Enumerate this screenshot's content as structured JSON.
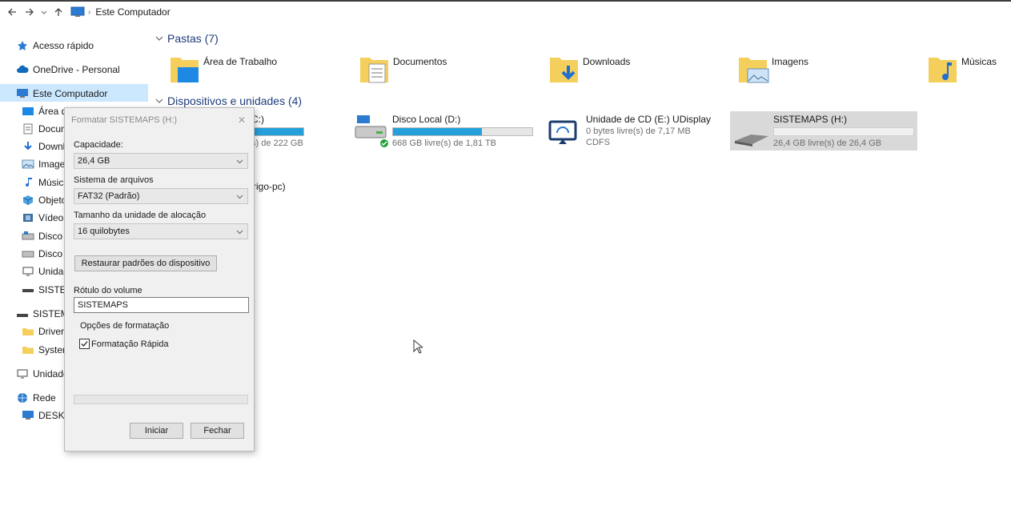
{
  "address": {
    "path": "Este Computador"
  },
  "sidebar": {
    "items": [
      {
        "label": "Acesso rápido"
      },
      {
        "label": "OneDrive - Personal"
      },
      {
        "label": "Este Computador"
      },
      {
        "label": "Área de Trabalho"
      },
      {
        "label": "Documentos"
      },
      {
        "label": "Downloads"
      },
      {
        "label": "Imagens"
      },
      {
        "label": "Músicas"
      },
      {
        "label": "Objetos 3D"
      },
      {
        "label": "Vídeos"
      },
      {
        "label": "Disco Local (C:)"
      },
      {
        "label": "Disco Local (D:)"
      },
      {
        "label": "Unidade de CD (E:)"
      },
      {
        "label": "SISTEMAPS (H:)"
      },
      {
        "label": "SISTEMAPS (H:)"
      },
      {
        "label": "Driver Pack"
      },
      {
        "label": "System"
      },
      {
        "label": "Unidade de CD (E:)"
      },
      {
        "label": "Rede"
      },
      {
        "label": "DESKTOP"
      }
    ]
  },
  "folders_section": {
    "title": "Pastas (7)",
    "items": [
      {
        "label": "Área de Trabalho"
      },
      {
        "label": "Documentos"
      },
      {
        "label": "Downloads"
      },
      {
        "label": "Imagens"
      },
      {
        "label": "Músicas"
      }
    ]
  },
  "devices_section": {
    "title": "Dispositivos e unidades (4)",
    "drives": [
      {
        "name": "C:)",
        "free": "s) de 222 GB",
        "used_fraction": 0.72
      },
      {
        "name": "Disco Local (D:)",
        "free": "668 GB livre(s) de 1,81 TB",
        "used_fraction": 0.64
      },
      {
        "name": "Unidade de CD (E:) UDisplay",
        "free": "0 bytes livre(s) de 7,17 MB",
        "fs": "CDFS"
      },
      {
        "name": "SISTEMAPS (H:)",
        "free": "26,4 GB livre(s) de 26,4 GB",
        "used_fraction": 0.0
      }
    ],
    "network_partial": "rigo-pc)"
  },
  "dialog": {
    "title": "Formatar SISTEMAPS (H:)",
    "close": "✕",
    "capacity_label": "Capacidade:",
    "capacity_value": "26,4 GB",
    "fs_label": "Sistema de arquivos",
    "fs_value": "FAT32 (Padrão)",
    "alloc_label": "Tamanho da unidade de alocação",
    "alloc_value": "16 quilobytes",
    "restore_button": "Restaurar padrões do dispositivo",
    "volume_label": "Rótulo do volume",
    "volume_value": "SISTEMAPS",
    "options_label": "Opções de formatação",
    "quick_format_label": "Formatação Rápida",
    "quick_format_checked": true,
    "start_button": "Iniciar",
    "close_button": "Fechar"
  },
  "colors": {
    "selection": "#cce8ff",
    "drive_bar": "#26a0da",
    "section_header": "#1e3c7a"
  }
}
